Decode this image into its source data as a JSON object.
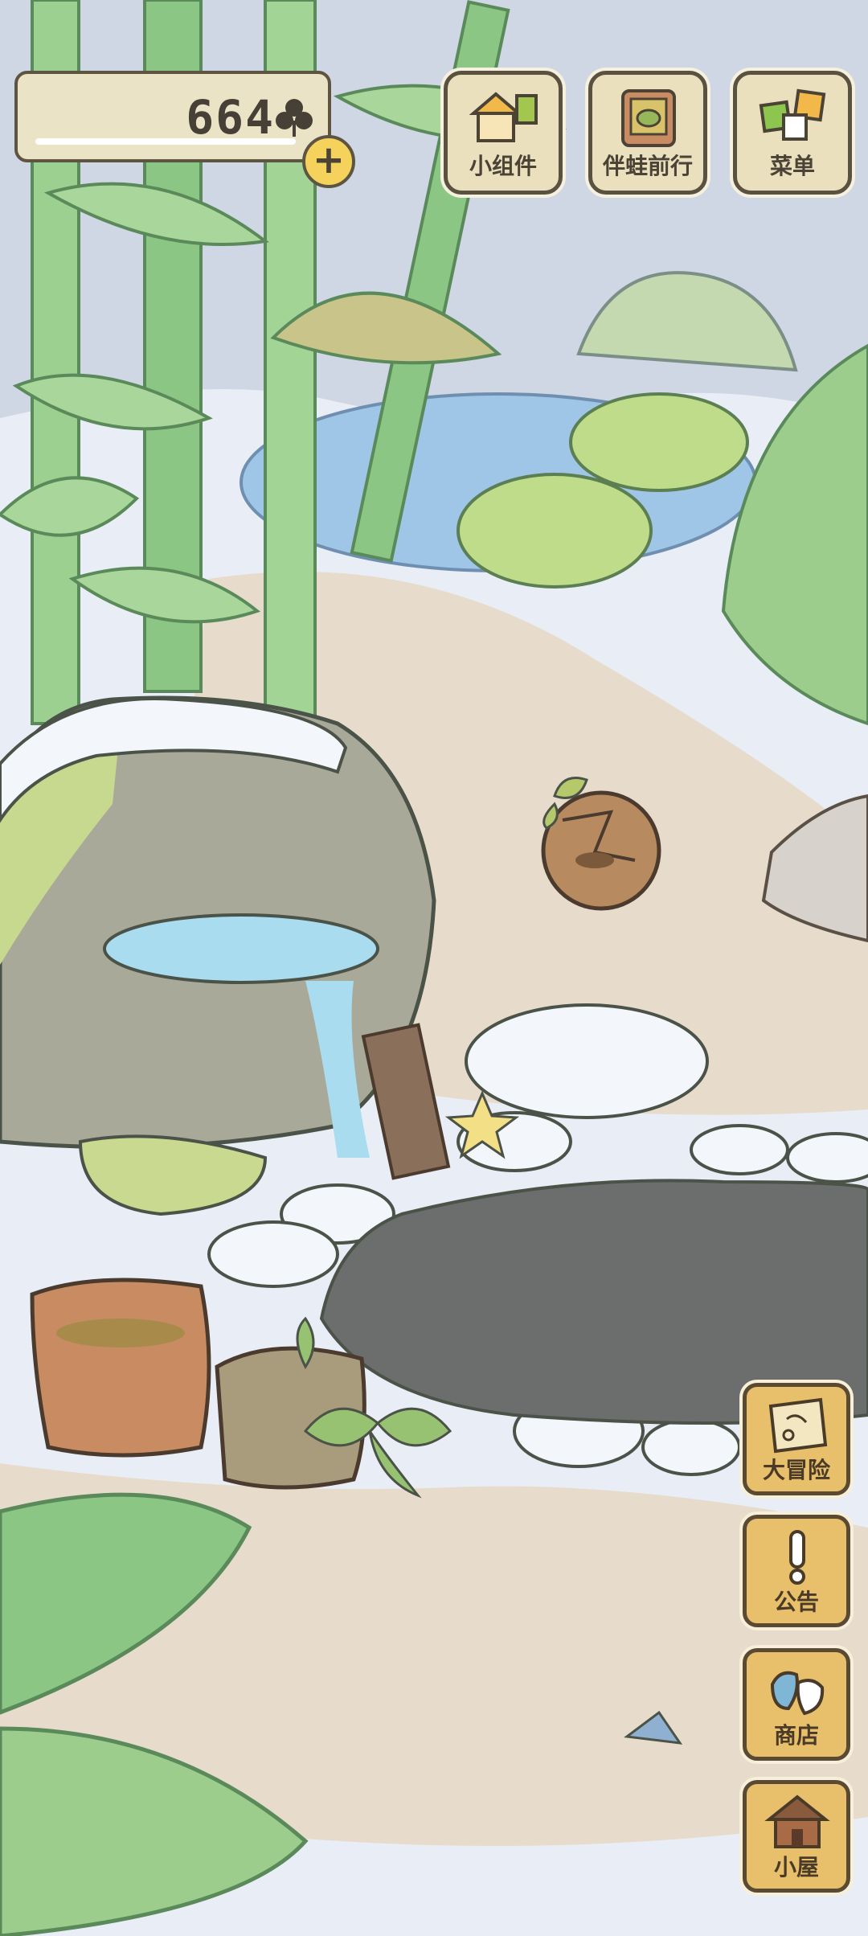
{
  "currency": {
    "amount": "664",
    "icon": "clover-icon",
    "add_icon": "plus-icon",
    "add_label": "+"
  },
  "top_menu": [
    {
      "label": "小组件",
      "icon": "widget-icon"
    },
    {
      "label": "伴蛙前行",
      "icon": "frog-journey-icon"
    },
    {
      "label": "菜单",
      "icon": "menu-cards-icon"
    }
  ],
  "side_menu": [
    {
      "label": "大冒险",
      "icon": "adventure-map-icon"
    },
    {
      "label": "公告",
      "icon": "exclamation-icon"
    },
    {
      "label": "商店",
      "icon": "shop-bag-icon"
    },
    {
      "label": "小屋",
      "icon": "house-icon"
    }
  ],
  "colors": {
    "snow": "#e9edf6",
    "soil": "#6b6e6c",
    "sand": "#e7dccb",
    "bamboo": "#8bc485",
    "button_bg": "#ebe0bd",
    "side_button_bg": "#e8bf6a",
    "outline": "#5a5140"
  }
}
